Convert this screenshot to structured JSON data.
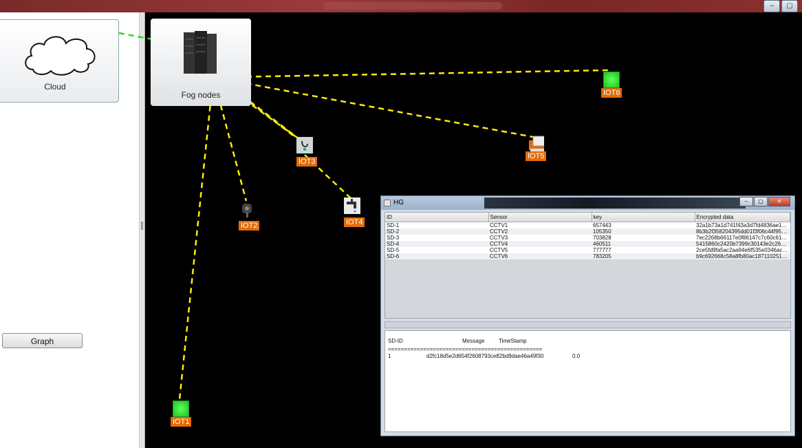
{
  "window": {
    "controls": [
      "minimize",
      "maximize"
    ]
  },
  "sidebar": {
    "cloud_label": "Cloud",
    "graph_button": "Graph"
  },
  "topology": {
    "fog_label": "Fog nodes",
    "devices": [
      {
        "label": "IOT1",
        "icon": "green-sensor-icon"
      },
      {
        "label": "IOT2",
        "icon": "mailbox-icon"
      },
      {
        "label": "IOT3",
        "icon": "bell-device-icon"
      },
      {
        "label": "IOT4",
        "icon": "faucet-icon"
      },
      {
        "label": "IOT5",
        "icon": "printer-icon"
      },
      {
        "label": "IOT6",
        "icon": "green-sensor-icon"
      }
    ],
    "colors": {
      "cloud_link": "#22dd22",
      "device_link": "#ffee00",
      "label_bg": "#e36c0a"
    }
  },
  "hg_window": {
    "title": "HG",
    "columns": [
      "ID",
      "Sensor",
      "key",
      "Encrypted data"
    ],
    "rows": [
      [
        "SD-1",
        "CCTV1",
        "657443",
        "32a1b73a1d741f43a3d7fd4836ae140e2..."
      ],
      [
        "SD-2",
        "CCTV2",
        "105350",
        "8b3b2f358204395dd01f3f06c44f956709..."
      ],
      [
        "SD-3",
        "CCTV3",
        "703828",
        "7ec2268b66117e0f86147c7c60c61847a..."
      ],
      [
        "SD-4",
        "CCTV4",
        "460511",
        "5415860c2420b7399c30143e2c260670..."
      ],
      [
        "SD-5",
        "CCTV5",
        "777777",
        "2ce5fd9fa5ac2aa94e6f535e0346ac7f29..."
      ],
      [
        "SD-6",
        "CCTV6",
        "783205",
        "b9c692668c58a8fb80ac18711025182eb..."
      ]
    ],
    "log": {
      "header_id": "SD-ID",
      "header_message": "Message",
      "header_timestamp": "TimeStamp",
      "separator": "================================================",
      "entry_id": "1",
      "entry_message": "d2fc18d5e2d654f2608793ce82bd9dae46a49f30",
      "entry_timestamp": "0.0"
    }
  }
}
